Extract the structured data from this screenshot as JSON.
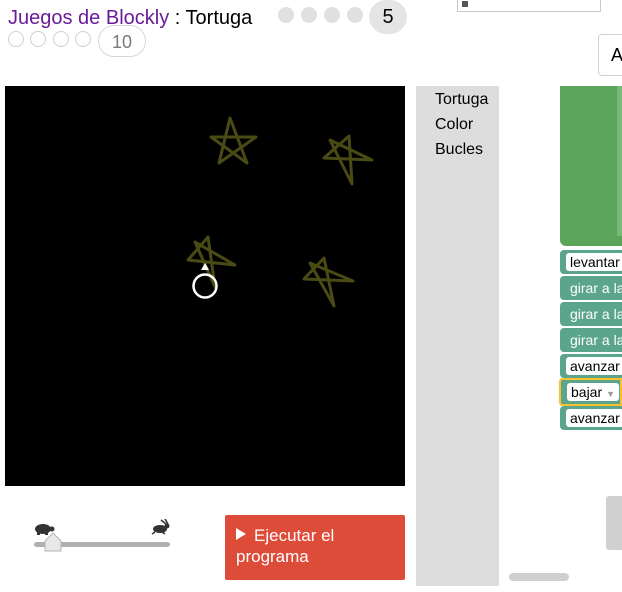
{
  "header": {
    "link_text": "Juegos de Blockly",
    "separator": ":",
    "page_name": "Tortuga",
    "current_level": "5",
    "max_level": "10",
    "top_right_button": "A"
  },
  "toolbox": {
    "categories": [
      "Tortuga",
      "Color",
      "Bucles"
    ]
  },
  "blocks": [
    {
      "label": "levantar",
      "style": "field"
    },
    {
      "label": "girar a la",
      "style": "text"
    },
    {
      "label": "girar a la",
      "style": "text"
    },
    {
      "label": "girar a la",
      "style": "text"
    },
    {
      "label": "avanzar",
      "style": "field"
    },
    {
      "label": "bajar",
      "style": "field",
      "selected": true
    },
    {
      "label": "avanzar",
      "style": "field"
    }
  ],
  "controls": {
    "run_line1": "Ejecutar el",
    "run_line2": "programa"
  },
  "colors": {
    "run_button": "#dd4b39",
    "star_stroke": "#4a4a14",
    "block_green": "#5ba55b",
    "block_teal": "#5ba58c"
  }
}
